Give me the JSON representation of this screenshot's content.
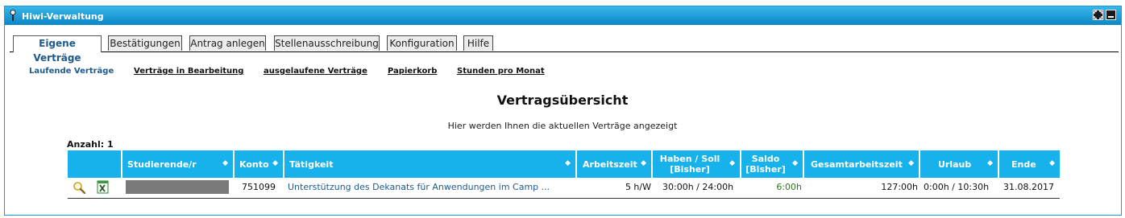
{
  "window": {
    "title": "Hiwi-Verwaltung"
  },
  "tabs": [
    {
      "label": "Eigene Verträge",
      "active": true
    },
    {
      "label": "Bestätigungen"
    },
    {
      "label": "Antrag anlegen"
    },
    {
      "label": "Stellenausschreibung"
    },
    {
      "label": "Konfiguration"
    },
    {
      "label": "Hilfe"
    }
  ],
  "subnav": [
    {
      "label": "Laufende Verträge",
      "active": true
    },
    {
      "label": "Verträge in Bearbeitung"
    },
    {
      "label": "ausgelaufene Verträge"
    },
    {
      "label": "Papierkorb"
    },
    {
      "label": "Stunden pro Monat"
    }
  ],
  "main": {
    "heading": "Vertragsübersicht",
    "subtitle": "Hier werden Ihnen die aktuellen Verträge angezeigt",
    "count_label": "Anzahl: 1"
  },
  "table": {
    "columns": [
      "Studierende/r",
      "Konto",
      "Tätigkeit",
      "Arbeitszeit",
      "Haben / Soll [Bisher]",
      "Saldo [Bisher]",
      "Gesamtarbeitszeit",
      "Urlaub",
      "Ende"
    ],
    "sort_glyph": "◆",
    "rows": [
      {
        "konto": "751099",
        "taetigkeit": "Unterstützung des Dekanats für Anwendungen im Camp ...",
        "arbeitszeit": "5 h/W",
        "haben_soll": "30:00h / 24:00h",
        "saldo": "6:00h",
        "gesamt": "127:00h",
        "urlaub": "0:00h / 10:30h",
        "ende": "31.08.2017"
      }
    ]
  },
  "colors": {
    "titlebar": "#0a87c6",
    "header": "#17b2ec",
    "link": "#1e5a8d",
    "positive": "#2b7a1d"
  }
}
